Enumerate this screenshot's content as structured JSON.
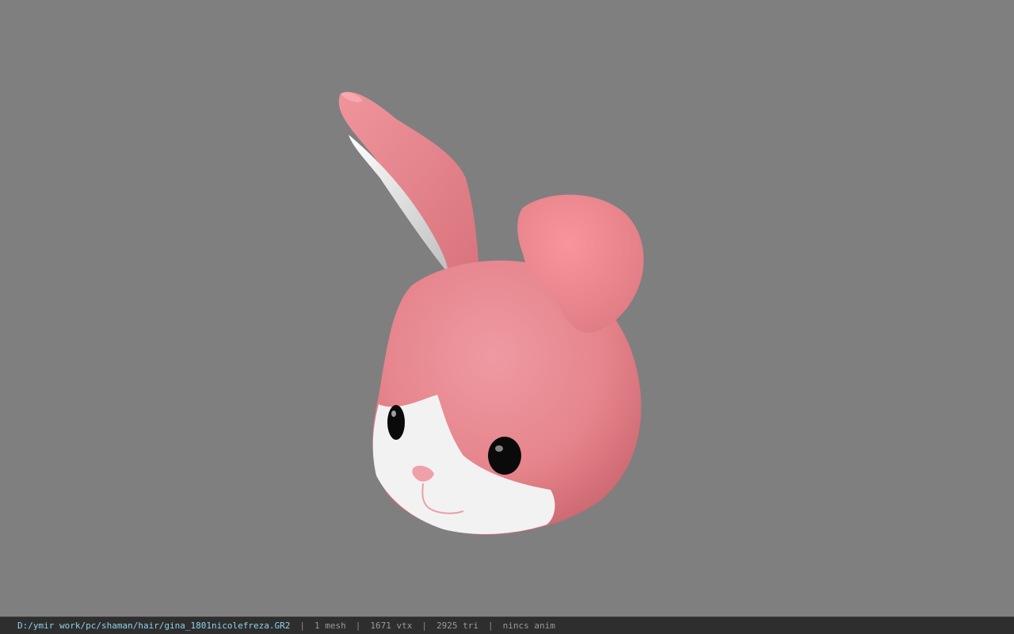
{
  "viewer": {
    "background_color": "#7f7f7f",
    "model_colors": {
      "fur_pink": "#e8868e",
      "fur_white": "#f2f2f2",
      "inner_ear": "#e6e6e6",
      "eye": "#0a0a0a",
      "nose": "#f0a0a8"
    }
  },
  "status": {
    "file_path": "D:/ymir work/pc/shaman/hair/gina_1801nicolefreza.GR2",
    "separator": "|",
    "mesh_count": "1 mesh",
    "vertex_count": "1671 vtx",
    "triangle_count": "2925 tri",
    "anim_status": "nincs anim",
    "path_color": "#8fd3e8"
  }
}
